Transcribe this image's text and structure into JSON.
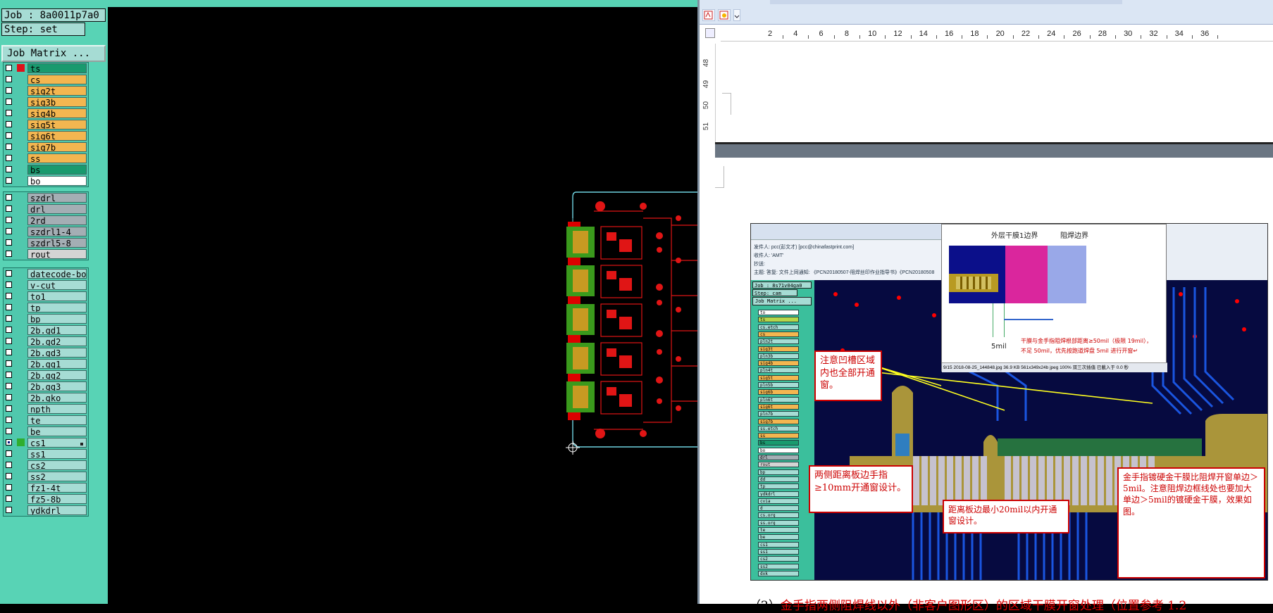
{
  "cam": {
    "job_label": "Job : 8a0011p7a0",
    "step_label": "Step: set",
    "matrix_button": "Job Matrix ...",
    "groups": [
      {
        "layers": [
          {
            "name": "ts",
            "color": "#199a6e",
            "mark": "#e0101a"
          },
          {
            "name": "cs",
            "color": "#f3b650"
          },
          {
            "name": "sig2t",
            "color": "#f3b650"
          },
          {
            "name": "sig3b",
            "color": "#f3b650"
          },
          {
            "name": "sig4b",
            "color": "#f3b650"
          },
          {
            "name": "sig5t",
            "color": "#f3b650"
          },
          {
            "name": "sig6t",
            "color": "#f3b650"
          },
          {
            "name": "sig7b",
            "color": "#f3b650"
          },
          {
            "name": "ss",
            "color": "#f3b650"
          },
          {
            "name": "bs",
            "color": "#199a6e"
          },
          {
            "name": "bo",
            "color": "#ffffff"
          }
        ]
      },
      {
        "layers": [
          {
            "name": "szdrl",
            "color": "#a4aeb4"
          },
          {
            "name": "drl",
            "color": "#a4aeb4"
          },
          {
            "name": "2rd",
            "color": "#a4aeb4"
          },
          {
            "name": "szdrl1-4",
            "color": "#a4aeb4"
          },
          {
            "name": "szdrl5-8",
            "color": "#a4aeb4"
          },
          {
            "name": "rout",
            "color": "#d4d4d4"
          }
        ]
      },
      {
        "layers": [
          {
            "name": "datecode-bo",
            "color": "#a6dcd4"
          },
          {
            "name": "v-cut",
            "color": "#a6dcd4"
          },
          {
            "name": "to1",
            "color": "#a6dcd4"
          },
          {
            "name": "tp",
            "color": "#a6dcd4"
          },
          {
            "name": "bp",
            "color": "#a6dcd4"
          },
          {
            "name": "2b.gd1",
            "color": "#a6dcd4"
          },
          {
            "name": "2b.gd2",
            "color": "#a6dcd4"
          },
          {
            "name": "2b.gd3",
            "color": "#a6dcd4"
          },
          {
            "name": "2b.gg1",
            "color": "#a6dcd4"
          },
          {
            "name": "2b.gg2",
            "color": "#a6dcd4"
          },
          {
            "name": "2b.gg3",
            "color": "#a6dcd4"
          },
          {
            "name": "2b.gko",
            "color": "#a6dcd4"
          },
          {
            "name": "npth",
            "color": "#a6dcd4"
          },
          {
            "name": "te",
            "color": "#a6dcd4"
          },
          {
            "name": "be",
            "color": "#a6dcd4"
          },
          {
            "name": "cs1",
            "color": "#a6dcd4",
            "mark": "#2fae2f",
            "checked": true
          },
          {
            "name": "ss1",
            "color": "#a6dcd4"
          },
          {
            "name": "cs2",
            "color": "#a6dcd4"
          },
          {
            "name": "ss2",
            "color": "#a6dcd4"
          },
          {
            "name": "fz1-4t",
            "color": "#a6dcd4"
          },
          {
            "name": "fz5-8b",
            "color": "#a6dcd4"
          },
          {
            "name": "ydkdrl",
            "color": "#a6dcd4"
          }
        ]
      }
    ]
  },
  "doc": {
    "ruler_marks": [
      "2",
      "4",
      "6",
      "8",
      "10",
      "12",
      "14",
      "16",
      "18",
      "20",
      "22",
      "24",
      "26",
      "28",
      "30",
      "32",
      "34",
      "36"
    ],
    "vruler_marks": [
      "48",
      "49",
      "50",
      "51"
    ],
    "figure": {
      "mail_from": "发件人: pcc(彭文才) [pcc@chinafastprint.com]",
      "mail_to": "收件人: 'AMT'",
      "mail_cc": "抄送:",
      "mail_subject": "主题: 答复: 文件上同通知: 《PCN20180507-阻焊丝印作业指导书》《PCN20180508",
      "inner_job": "Job : 8s71v04ga0",
      "inner_step": "Step: cam",
      "inner_matrix": "Job Matrix ...",
      "inner_layers": [
        "to",
        "ts",
        "cs.etch",
        "cs",
        "pln2t",
        "sig3t",
        "pln3b",
        "sig4b",
        "pln4t",
        "sig5t",
        "pln5b",
        "sig6b",
        "pln6t",
        "sig6t",
        "pln7b",
        "sig7b",
        "ss.etch",
        "ss",
        "bs",
        "bo",
        "drl",
        "rout",
        "bp",
        "dd",
        "tp",
        "ydkdrl",
        "cvia",
        "d",
        "cs.org",
        "ss.org",
        "te",
        "be",
        "cs1",
        "ss1",
        "cs2",
        "ss2",
        "dxk"
      ],
      "popup_label_left": "外层干膜1边界",
      "popup_label_right": "阻焊边界",
      "popup_dim": "5mil",
      "popup_note1": "干膜与金手指阻焊根部距离≥50mil（极限 19mil），",
      "popup_note2": "不足 50mil，优先按跑道焊盘 5mil 进行开窗↵",
      "popup_status": "9/15   2018-08-25_144848.jpg   36.9 KB   561x349x24b jpeg   100%   双三次插值   已載入于 0.0 秒",
      "callout1": "注意凹槽区域内也全部开通窗。",
      "callout2": "两侧距离板边手指≥10mm开通窗设计。",
      "callout3": "距离板边最小20mil以内开通窗设计。",
      "callout4": "金手指镀硬金干膜比阻焊开窗单边＞5mil。注意阻焊边框线处也要加大单边＞5mil的镀硬金干膜，效果如图。"
    },
    "bottom_prefix": "（2）",
    "bottom_text": "金手指两侧阻焊线以外（非客户图形区）的区域干膜开窗处理（位置参考 1.2"
  }
}
